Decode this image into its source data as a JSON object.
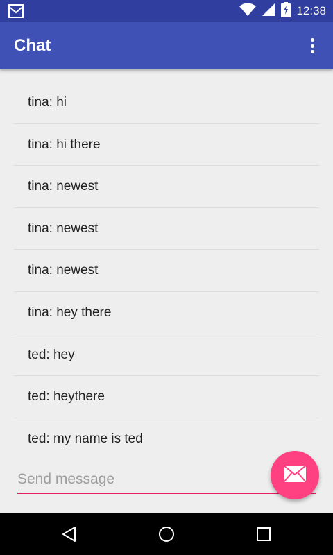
{
  "status_bar": {
    "time": "12:38",
    "icons": [
      "mail-icon",
      "wifi-icon",
      "signal-icon",
      "battery-charging-icon"
    ]
  },
  "app_bar": {
    "title": "Chat",
    "menu_icon": "more-vert-icon"
  },
  "messages": [
    "tina: hi",
    "tina: hi there",
    "tina: newest",
    "tina: newest",
    "tina: newest",
    "tina: hey there",
    "ted: hey",
    "ted: heythere",
    "ted: my name is ted"
  ],
  "compose": {
    "placeholder": "Send message",
    "value": ""
  },
  "fab": {
    "icon": "envelope-icon"
  },
  "nav_bar": {
    "icons": [
      "back-icon",
      "home-icon",
      "recents-icon"
    ]
  },
  "colors": {
    "primary": "#3f51b5",
    "primary_dark": "#303f9f",
    "accent": "#ff4081",
    "underline": "#e91e63"
  }
}
